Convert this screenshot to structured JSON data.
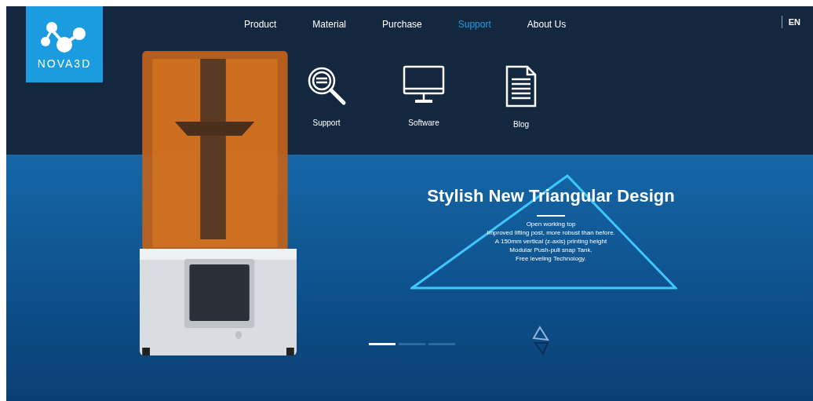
{
  "logo": {
    "text": "NOVA3D"
  },
  "nav": [
    {
      "label": "Product",
      "selected": false
    },
    {
      "label": "Material",
      "selected": false
    },
    {
      "label": "Purchase",
      "selected": false
    },
    {
      "label": "Support",
      "selected": true
    },
    {
      "label": "About Us",
      "selected": false
    }
  ],
  "language": "EN",
  "submenu": [
    {
      "kind": "search",
      "label": "Support"
    },
    {
      "kind": "monitor",
      "label": "Software"
    },
    {
      "kind": "document",
      "label": "Blog"
    }
  ],
  "hero": {
    "title": "Stylish New Triangular Design",
    "lines": [
      "Open working top",
      "Improved lifting post, more robust than before.",
      "A 150mm vertical (z-axis) printing height",
      "Modular Push-pull snap Tank.",
      "Free leveling Technology."
    ]
  },
  "carousel": [
    {
      "selected": true
    },
    {
      "selected": false
    },
    {
      "selected": false
    }
  ]
}
